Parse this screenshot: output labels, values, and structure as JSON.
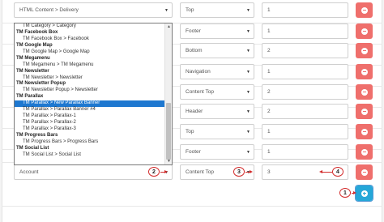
{
  "rows": [
    {
      "module": "HTML Content > Delivery",
      "position": "Top",
      "order": "1"
    },
    {
      "module": "",
      "position": "Footer",
      "order": "1"
    },
    {
      "module": "",
      "position": "Bottom",
      "order": "2"
    },
    {
      "module": "",
      "position": "Navigation",
      "order": "1"
    },
    {
      "module": "",
      "position": "Content Top",
      "order": "2"
    },
    {
      "module": "",
      "position": "Header",
      "order": "2"
    },
    {
      "module": "",
      "position": "Top",
      "order": "1"
    },
    {
      "module": "",
      "position": "Footer",
      "order": "1"
    },
    {
      "module": "Account",
      "position": "Content Top",
      "order": "3"
    }
  ],
  "dropdown": {
    "items": [
      {
        "label": "TM Category > Category",
        "kind": "opt"
      },
      {
        "label": "TM Facebook Box",
        "kind": "group"
      },
      {
        "label": "TM Facebook Box > Facebook",
        "kind": "opt"
      },
      {
        "label": "TM Google Map",
        "kind": "group"
      },
      {
        "label": "TM Google Map > Google Map",
        "kind": "opt"
      },
      {
        "label": "TM Megamenu",
        "kind": "group"
      },
      {
        "label": "TM Megamenu > TM Megamenu",
        "kind": "opt"
      },
      {
        "label": "TM Newsletter",
        "kind": "group"
      },
      {
        "label": "TM Newsletter > Newsletter",
        "kind": "opt"
      },
      {
        "label": "TM Newsletter Popup",
        "kind": "group"
      },
      {
        "label": "TM Newsletter Popup > Newsletter",
        "kind": "opt"
      },
      {
        "label": "TM Parallax",
        "kind": "group"
      },
      {
        "label": "TM Parallax > New Parallax Banner",
        "kind": "opt",
        "selected": true
      },
      {
        "label": "TM Parallax > Parallax Banner #4",
        "kind": "opt"
      },
      {
        "label": "TM Parallax > Parallax-1",
        "kind": "opt"
      },
      {
        "label": "TM Parallax > Parallax-2",
        "kind": "opt"
      },
      {
        "label": "TM Parallax > Parallax-3",
        "kind": "opt"
      },
      {
        "label": "TM Progress Bars",
        "kind": "group"
      },
      {
        "label": "TM Progress Bars > Progress Bars",
        "kind": "opt"
      },
      {
        "label": "TM Social List",
        "kind": "group"
      },
      {
        "label": "TM Social List > Social List",
        "kind": "opt"
      }
    ]
  },
  "annotations": {
    "step1": "1",
    "step2": "2",
    "step3": "3",
    "step4": "4"
  },
  "icons": {
    "remove": "minus-circle-icon",
    "add": "plus-circle-icon",
    "caret": "caret-down-icon"
  },
  "colors": {
    "remove_button": "#ef6f6c",
    "add_button": "#25a7d8",
    "selected_option": "#1e78d0",
    "annotation": "#d22b2b"
  }
}
